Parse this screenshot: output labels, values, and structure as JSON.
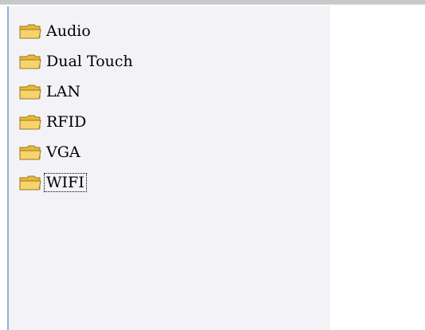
{
  "tree": {
    "items": [
      {
        "label": "Audio",
        "icon": "folder-icon"
      },
      {
        "label": "Dual Touch",
        "icon": "folder-icon"
      },
      {
        "label": "LAN",
        "icon": "folder-icon"
      },
      {
        "label": "RFID",
        "icon": "folder-icon"
      },
      {
        "label": "VGA",
        "icon": "folder-icon"
      },
      {
        "label": "WIFI",
        "icon": "folder-icon",
        "focused": true
      }
    ]
  },
  "colors": {
    "tree_background": "#f3f3f7",
    "tree_left_border": "#8fb0d8",
    "folder_fill": "#f6d36b",
    "folder_outline": "#9a7a1c"
  }
}
